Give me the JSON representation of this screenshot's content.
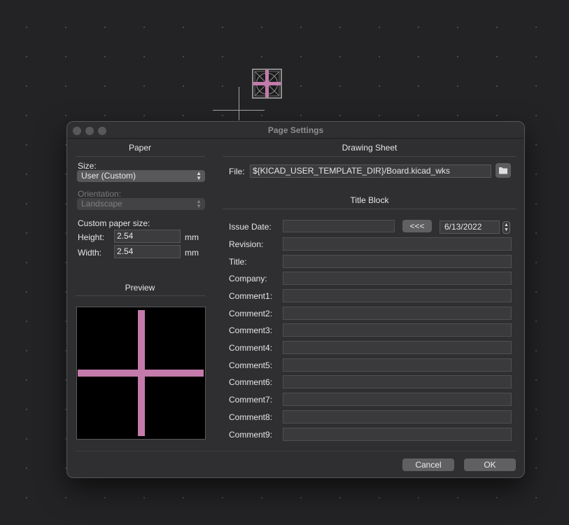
{
  "window": {
    "title": "Page Settings"
  },
  "paper": {
    "section_title": "Paper",
    "size_label": "Size:",
    "size_value": "User (Custom)",
    "orientation_label": "Orientation:",
    "orientation_value": "Landscape",
    "custom_size_label": "Custom paper size:",
    "height_label": "Height:",
    "height_value": "2.54",
    "height_unit": "mm",
    "width_label": "Width:",
    "width_value": "2.54",
    "width_unit": "mm",
    "preview_title": "Preview"
  },
  "drawing_sheet": {
    "section_title": "Drawing Sheet",
    "file_label": "File:",
    "file_value": "${KICAD_USER_TEMPLATE_DIR}/Board.kicad_wks",
    "browse_icon": "folder-icon"
  },
  "title_block": {
    "section_title": "Title Block",
    "issue_date_label": "Issue Date:",
    "issue_date_value": "",
    "copy_date_label": "<<<",
    "date_value": "6/13/2022",
    "fields": [
      {
        "label": "Revision:",
        "value": ""
      },
      {
        "label": "Title:",
        "value": ""
      },
      {
        "label": "Company:",
        "value": ""
      },
      {
        "label": "Comment1:",
        "value": ""
      },
      {
        "label": "Comment2:",
        "value": ""
      },
      {
        "label": "Comment3:",
        "value": ""
      },
      {
        "label": "Comment4:",
        "value": ""
      },
      {
        "label": "Comment5:",
        "value": ""
      },
      {
        "label": "Comment6:",
        "value": ""
      },
      {
        "label": "Comment7:",
        "value": ""
      },
      {
        "label": "Comment8:",
        "value": ""
      },
      {
        "label": "Comment9:",
        "value": ""
      }
    ]
  },
  "buttons": {
    "cancel": "Cancel",
    "ok": "OK"
  },
  "colors": {
    "accent_pink": "#c47bab",
    "dialog_bg": "#2f2f31",
    "canvas_bg": "#232325"
  }
}
